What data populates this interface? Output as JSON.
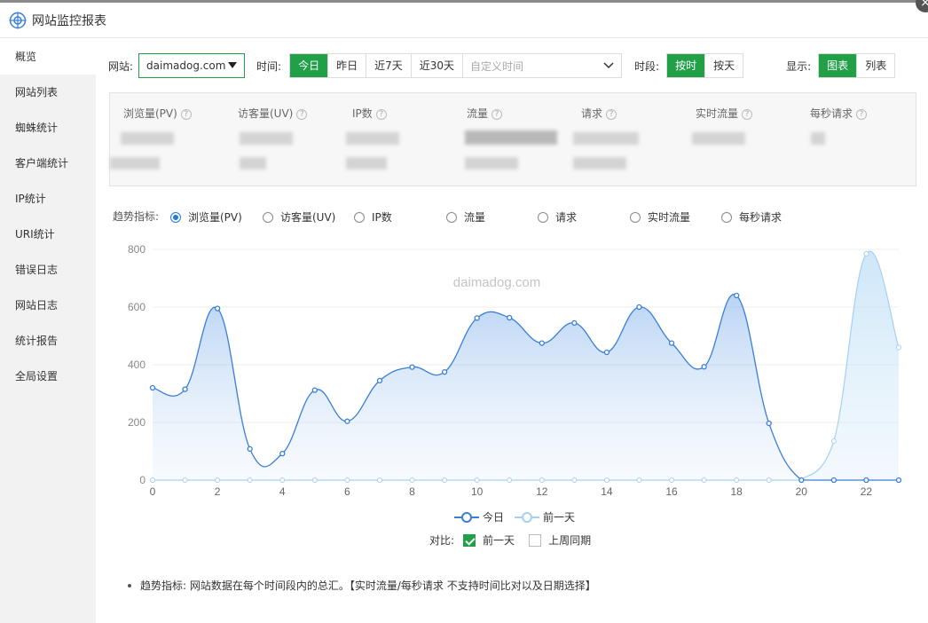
{
  "window": {
    "title": "网站监控报表",
    "close_label": "×"
  },
  "sidebar": {
    "items": [
      {
        "label": "概览",
        "active": true
      },
      {
        "label": "网站列表"
      },
      {
        "label": "蜘蛛统计"
      },
      {
        "label": "客户端统计"
      },
      {
        "label": "IP统计"
      },
      {
        "label": "URI统计"
      },
      {
        "label": "错误日志"
      },
      {
        "label": "网站日志"
      },
      {
        "label": "统计报告"
      },
      {
        "label": "全局设置"
      }
    ]
  },
  "filters": {
    "site_label": "网站:",
    "site_value": "daimadog.com",
    "time_label": "时间:",
    "time_options": [
      "今日",
      "昨日",
      "近7天",
      "近30天"
    ],
    "time_selected": "今日",
    "date_placeholder": "自定义时间",
    "period_label": "时段:",
    "period_options": [
      "按时",
      "按天"
    ],
    "period_selected": "按时",
    "display_label": "显示:",
    "display_options": [
      "图表",
      "列表"
    ],
    "display_selected": "图表"
  },
  "stats": [
    {
      "name": "浏览量(PV)"
    },
    {
      "name": "访客量(UV)"
    },
    {
      "name": "IP数"
    },
    {
      "name": "流量"
    },
    {
      "name": "请求"
    },
    {
      "name": "实时流量"
    },
    {
      "name": "每秒请求"
    }
  ],
  "trend": {
    "label": "趋势指标:",
    "options": [
      "浏览量(PV)",
      "访客量(UV)",
      "IP数",
      "流量",
      "请求",
      "实时流量",
      "每秒请求"
    ],
    "selected": "浏览量(PV)"
  },
  "chart_data": {
    "type": "area",
    "watermark": "daimadog.com",
    "x": [
      0,
      1,
      2,
      3,
      4,
      5,
      6,
      7,
      8,
      9,
      10,
      11,
      12,
      13,
      14,
      15,
      16,
      17,
      18,
      19,
      20,
      21,
      22,
      23
    ],
    "x_ticks": [
      0,
      2,
      4,
      6,
      8,
      10,
      12,
      14,
      16,
      18,
      20,
      22
    ],
    "y_ticks": [
      0,
      200,
      400,
      600,
      800
    ],
    "ylim": [
      0,
      800
    ],
    "grid": true,
    "legend_position": "bottom",
    "series": [
      {
        "name": "今日",
        "color": "#3a7fd5",
        "values": [
          320,
          315,
          595,
          108,
          92,
          312,
          204,
          345,
          392,
          375,
          562,
          563,
          475,
          545,
          443,
          600,
          475,
          393,
          640,
          197,
          0,
          0,
          0,
          0
        ]
      },
      {
        "name": "前一天",
        "color": "#a6d0f2",
        "values": [
          0,
          0,
          0,
          0,
          0,
          0,
          0,
          0,
          0,
          0,
          0,
          0,
          0,
          0,
          0,
          0,
          0,
          0,
          0,
          0,
          0,
          135,
          785,
          460
        ]
      }
    ]
  },
  "compare": {
    "label": "对比:",
    "options": [
      {
        "label": "前一天",
        "checked": true
      },
      {
        "label": "上周同期",
        "checked": false
      }
    ]
  },
  "note": "趋势指标: 网站数据在每个时间段内的总汇。【实时流量/每秒请求 不支持时间比对以及日期选择】",
  "colors": {
    "accent_green": "#22a048",
    "today_line": "#3a7fd5",
    "yesterday_line": "#a6d0f2"
  }
}
